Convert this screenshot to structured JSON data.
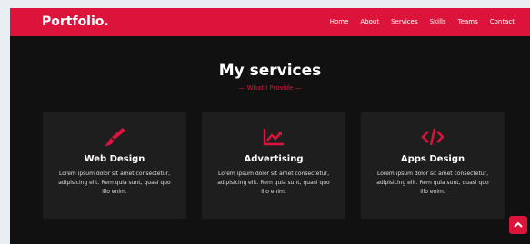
{
  "navbar": {
    "brand": "Portfolio.",
    "menu": [
      "Home",
      "About",
      "Services",
      "Skills",
      "Teams",
      "Contact"
    ]
  },
  "services": {
    "title": "My services",
    "subtitle": "— What I Provide —",
    "cards": [
      {
        "icon": "paint-brush-icon",
        "title": "Web Design",
        "text": "Lorem ipsum dolor sit amet consectetur, adipisicing elit. Rem quia sunt, quasi quo illo enim."
      },
      {
        "icon": "chart-line-icon",
        "title": "Advertising",
        "text": "Lorem ipsum dolor sit amet consectetur, adipisicing elit. Rem quia sunt, quasi quo illo enim."
      },
      {
        "icon": "code-icon",
        "title": "Apps Design",
        "text": "Lorem ipsum dolor sit amet consectetur, adipisicing elit. Rem quia sunt, quasi quo illo enim."
      }
    ]
  },
  "scroll_top": {
    "icon": "chevron-up-icon"
  },
  "colors": {
    "accent": "#dc143c",
    "background": "#111111",
    "card": "#1e1e1e",
    "page_bg": "#e9eef3"
  }
}
